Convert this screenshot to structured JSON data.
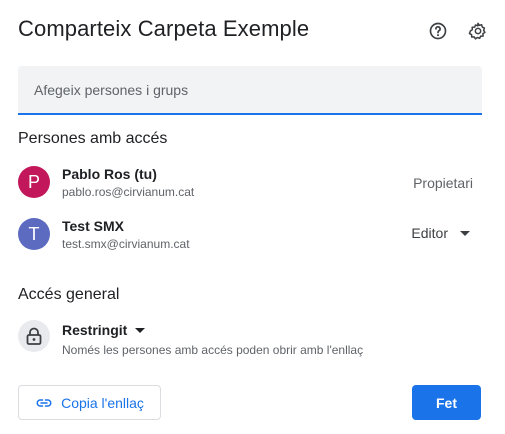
{
  "dialog": {
    "title": "Comparteix Carpeta Exemple"
  },
  "header_icons": {
    "help": "help-icon",
    "settings": "gear-icon"
  },
  "add_people": {
    "placeholder": "Afegeix persones i grups",
    "value": ""
  },
  "people_section": {
    "title": "Persones amb accés",
    "people": [
      {
        "initial": "P",
        "avatar_color": "#c2185b",
        "name": "Pablo Ros (tu)",
        "email": "pablo.ros@cirvianum.cat",
        "role": "Propietari",
        "role_editable": false
      },
      {
        "initial": "T",
        "avatar_color": "#5c6bc0",
        "name": "Test SMX",
        "email": "test.smx@cirvianum.cat",
        "role": "Editor",
        "role_editable": true
      }
    ]
  },
  "general_access": {
    "title": "Accés general",
    "icon": "lock-icon",
    "mode": "Restringit",
    "description": "Només les persones amb accés poden obrir amb l'enllaç"
  },
  "footer": {
    "copy_link_label": "Copia l'enllaç",
    "copy_link_icon": "link-icon",
    "done_label": "Fet"
  },
  "colors": {
    "accent": "#1a73e8",
    "text_primary": "#202124",
    "text_secondary": "#5f6368"
  }
}
